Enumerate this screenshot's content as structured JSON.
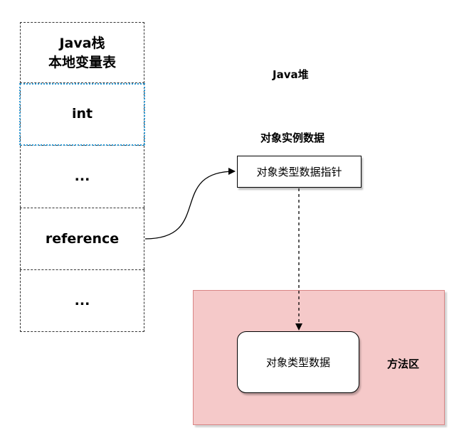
{
  "stack": {
    "title_line1": "Java栈",
    "title_line2": "本地变量表",
    "cells": [
      "int",
      "...",
      "reference",
      "..."
    ]
  },
  "heap": {
    "title": "Java堆",
    "instance_title": "对象实例数据",
    "pointer_label": "对象类型数据指针"
  },
  "method_area": {
    "title": "方法区",
    "type_data_label": "对象类型数据"
  },
  "colors": {
    "method_area_fill": "#f5c9c9",
    "method_area_border": "#d98585",
    "selection_dots": "#2e9bd6"
  }
}
